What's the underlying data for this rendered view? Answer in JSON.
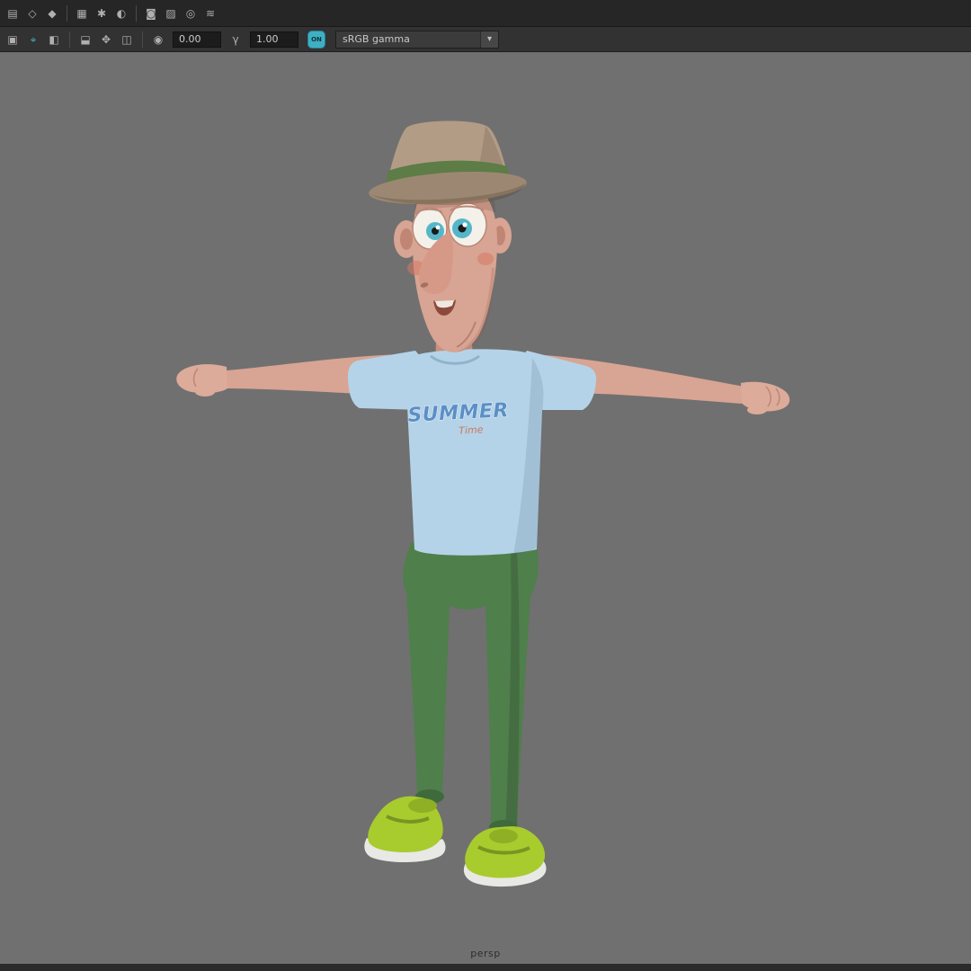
{
  "colors": {
    "viewport_bg": "#707070",
    "toolbar_bg": "#262626",
    "field_bg": "#1c1c1c",
    "accent_teal": "#3fb0c4"
  },
  "toolbar_row1": {
    "icons": [
      {
        "name": "panel-layout",
        "glyph": "▤"
      },
      {
        "name": "wireframe-mode",
        "glyph": "◇"
      },
      {
        "name": "shaded-mode",
        "glyph": "◆"
      },
      {
        "name": "textured-mode",
        "glyph": "▦"
      },
      {
        "name": "lighting-toggle",
        "glyph": "✱"
      },
      {
        "name": "shadows-toggle",
        "glyph": "◐"
      },
      {
        "name": "ambient-occlusion",
        "glyph": "◙"
      },
      {
        "name": "anti-aliasing",
        "glyph": "▨"
      },
      {
        "name": "depth-of-field",
        "glyph": "◎"
      },
      {
        "name": "motion-blur",
        "glyph": "≋"
      }
    ]
  },
  "toolbar_row2": {
    "icons": [
      {
        "name": "renderer-menu",
        "glyph": "▣"
      },
      {
        "name": "camera-select",
        "glyph": "⌖"
      },
      {
        "name": "camera-lock",
        "glyph": "◧"
      },
      {
        "name": "image-plane",
        "glyph": "⬓"
      },
      {
        "name": "2d-pan-zoom",
        "glyph": "✥"
      },
      {
        "name": "isolate-select",
        "glyph": "◫"
      },
      {
        "name": "exposure",
        "glyph": "◉"
      },
      {
        "name": "gamma",
        "glyph": "γ"
      }
    ],
    "exposure_value": "0.00",
    "gamma_value": "1.00",
    "color_management_toggle": "ON",
    "view_transform": "sRGB gamma",
    "dropdown_arrow": "▾"
  },
  "viewport": {
    "camera_label": "persp"
  },
  "character": {
    "shirt_logo_line1": "SUMMER",
    "shirt_logo_line2": "Time",
    "colors": {
      "skin": "#d8a493",
      "skin_shadow": "#c99180",
      "hands": "#dcab9a",
      "nose": "#d69887",
      "hat": "#b29c86",
      "hat_brim": "#9c8872",
      "hat_band": "#5d7c46",
      "shirt": "#b5d3e8",
      "pants": "#4f7f4b",
      "pants_dark": "#3f6a3c",
      "shoes": "#a8cb2e",
      "sole": "#e8e8e4",
      "iris": "#56b6c9",
      "logo_text": "#5b8fc6",
      "logo_sub": "#c8795f"
    }
  }
}
